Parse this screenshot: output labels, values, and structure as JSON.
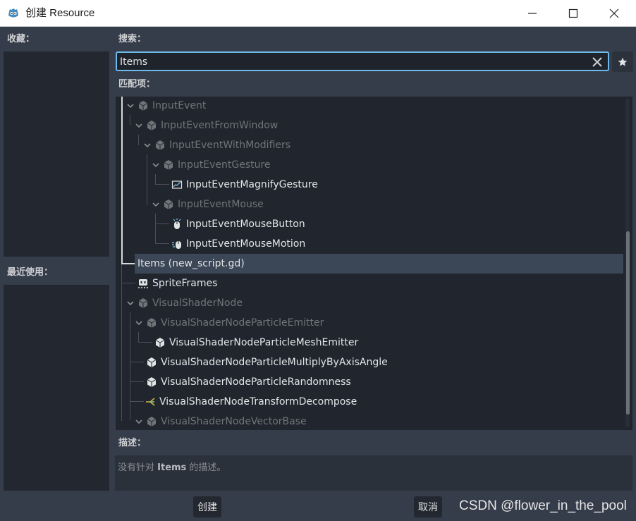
{
  "window": {
    "title": "创建 Resource"
  },
  "favorites": {
    "label": "收藏："
  },
  "recent": {
    "label": "最近使用："
  },
  "search": {
    "label": "搜索：",
    "value": "Items"
  },
  "matches": {
    "label": "匹配项：",
    "items": [
      {
        "label": "InputEvent",
        "state": "dim",
        "icon": "cube-icon"
      },
      {
        "label": "InputEventFromWindow",
        "state": "dim",
        "icon": "cube-icon"
      },
      {
        "label": "InputEventWithModifiers",
        "state": "dim",
        "icon": "cube-icon"
      },
      {
        "label": "InputEventGesture",
        "state": "dim",
        "icon": "cube-icon"
      },
      {
        "label": "InputEventMagnifyGesture",
        "state": "bright",
        "icon": "magnify-gesture-icon"
      },
      {
        "label": "InputEventMouse",
        "state": "dim",
        "icon": "cube-icon"
      },
      {
        "label": "InputEventMouseButton",
        "state": "bright",
        "icon": "mouse-button-icon"
      },
      {
        "label": "InputEventMouseMotion",
        "state": "bright",
        "icon": "mouse-motion-icon"
      },
      {
        "label": "Items (new_script.gd)",
        "state": "selected",
        "icon": ""
      },
      {
        "label": "SpriteFrames",
        "state": "bright",
        "icon": "sprite-frames-icon"
      },
      {
        "label": "VisualShaderNode",
        "state": "dim",
        "icon": "cube-icon"
      },
      {
        "label": "VisualShaderNodeParticleEmitter",
        "state": "dim",
        "icon": "cube-icon"
      },
      {
        "label": "VisualShaderNodeParticleMeshEmitter",
        "state": "bright",
        "icon": "cube-icon"
      },
      {
        "label": "VisualShaderNodeParticleMultiplyByAxisAngle",
        "state": "bright",
        "icon": "cube-icon"
      },
      {
        "label": "VisualShaderNodeParticleRandomness",
        "state": "bright",
        "icon": "cube-icon"
      },
      {
        "label": "VisualShaderNodeTransformDecompose",
        "state": "bright",
        "icon": "decompose-icon"
      },
      {
        "label": "VisualShaderNodeVectorBase",
        "state": "dim",
        "icon": "cube-icon"
      }
    ]
  },
  "description": {
    "label": "描述：",
    "prefix": "没有针对 ",
    "subject": "Items",
    "suffix": " 的描述。"
  },
  "footer": {
    "create_label": "创建",
    "cancel_label": "取消"
  },
  "watermark": "CSDN @flower_in_the_pool",
  "colors": {
    "accent": "#6fb8ec",
    "selection": "#3b4656",
    "background": "#363d4a"
  }
}
